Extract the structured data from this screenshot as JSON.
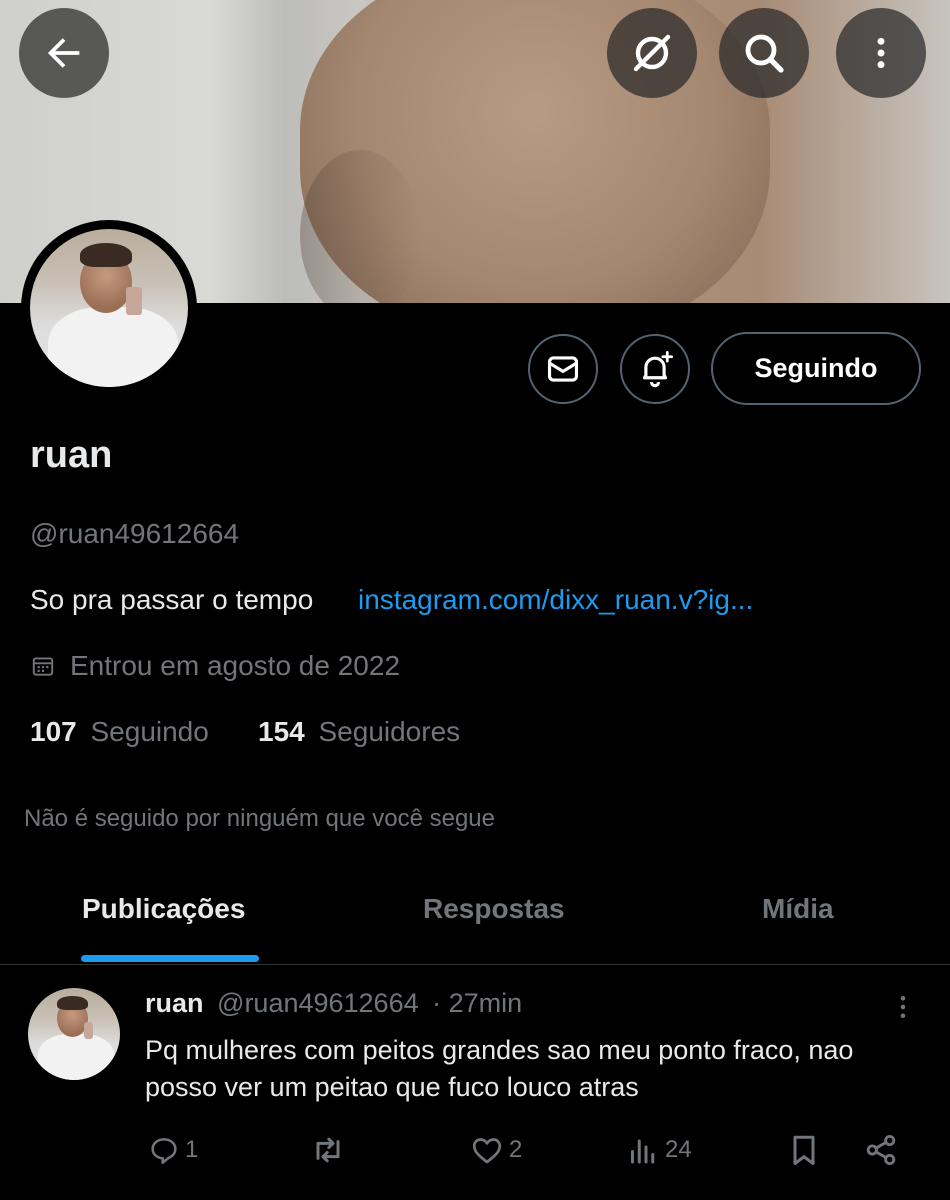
{
  "header": {
    "back_icon": "arrow-left-icon",
    "grok_icon": "slash-circle-icon",
    "search_icon": "search-icon",
    "more_icon": "more-vertical-icon"
  },
  "profile": {
    "display_name": "ruan",
    "handle": "@ruan49612664",
    "bio": "So pra passar o tempo",
    "link": "instagram.com/dixx_ruan.v?ig...",
    "joined": "Entrou em agosto de 2022",
    "following_count": "107",
    "following_label": "Seguindo",
    "followers_count": "154",
    "followers_label": "Seguidores",
    "mutuals_note": "Não é seguido por ninguém que você segue"
  },
  "actions": {
    "message_icon": "mail-icon",
    "notify_icon": "bell-plus-icon",
    "follow_label": "Seguindo"
  },
  "tabs": [
    {
      "label": "Publicações",
      "active": true
    },
    {
      "label": "Respostas",
      "active": false
    },
    {
      "label": "Mídia",
      "active": false
    }
  ],
  "post": {
    "author": "ruan",
    "handle": "@ruan49612664",
    "time": "· 27min",
    "text_line1": "Pq mulheres com peitos grandes sao meu ponto fraco, nao",
    "text_line2": "posso ver um peitao que fuco louco atras",
    "replies": "1",
    "reposts": "",
    "likes": "2",
    "views": "24"
  },
  "colors": {
    "accent": "#1d9bf0",
    "muted": "#71767b",
    "border": "#536471",
    "background": "#000000"
  }
}
